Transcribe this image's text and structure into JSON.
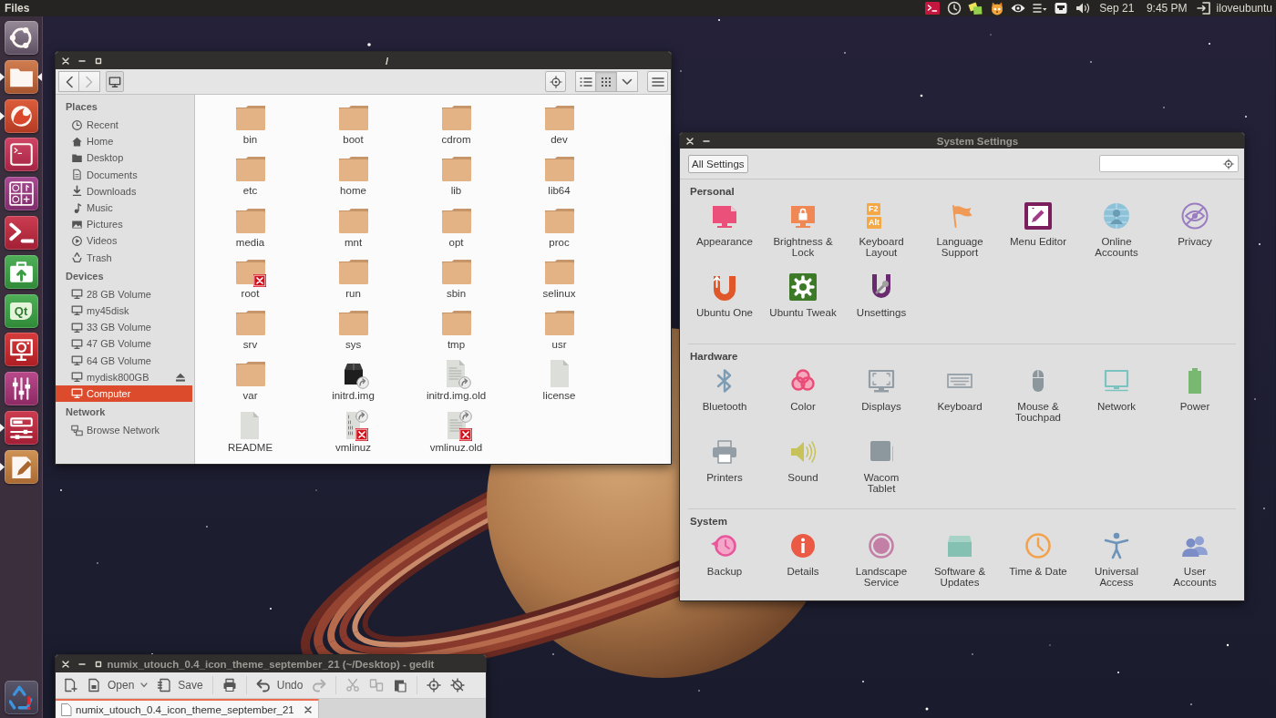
{
  "top_panel": {
    "app_title": "Files",
    "date": "Sep 21",
    "time": "9:45 PM",
    "user": "iloveubuntu"
  },
  "launcher": [
    {
      "running": false,
      "focused": false
    },
    {
      "running": true,
      "focused": true
    },
    {
      "running": true,
      "focused": false
    },
    {
      "running": false,
      "focused": false
    },
    {
      "running": false,
      "focused": false
    },
    {
      "running": false,
      "focused": false
    },
    {
      "running": false,
      "focused": false
    },
    {
      "running": false,
      "focused": false,
      "logo_text": "Qt"
    },
    {
      "running": false,
      "focused": false
    },
    {
      "running": false,
      "focused": false
    },
    {
      "running": true,
      "focused": false
    },
    {
      "running": true,
      "focused": false
    }
  ],
  "file_manager": {
    "title": "/",
    "nav": [
      {
        "disabled": false
      },
      {
        "disabled": true
      }
    ],
    "view_modes": [
      {
        "selected": false
      },
      {
        "selected": true
      }
    ],
    "sidebar": [
      {
        "heading": "Places",
        "items": [
          {
            "label": "Recent",
            "selected": false
          },
          {
            "label": "Home",
            "selected": false
          },
          {
            "label": "Desktop",
            "selected": false
          },
          {
            "label": "Documents",
            "selected": false
          },
          {
            "label": "Downloads",
            "selected": false
          },
          {
            "label": "Music",
            "selected": false
          },
          {
            "label": "Pictures",
            "selected": false
          },
          {
            "label": "Videos",
            "selected": false
          },
          {
            "label": "Trash",
            "selected": false
          }
        ]
      },
      {
        "heading": "Devices",
        "items": [
          {
            "label": "28 GB Volume",
            "selected": false,
            "eject": false
          },
          {
            "label": "my45disk",
            "selected": false,
            "eject": false
          },
          {
            "label": "33 GB Volume",
            "selected": false,
            "eject": false
          },
          {
            "label": "47 GB Volume",
            "selected": false,
            "eject": false
          },
          {
            "label": "64 GB Volume",
            "selected": false,
            "eject": false
          },
          {
            "label": "mydisk800GB",
            "selected": false,
            "eject": true
          },
          {
            "label": "Computer",
            "selected": true,
            "eject": false
          }
        ]
      },
      {
        "heading": "Network",
        "items": [
          {
            "label": "Browse Network",
            "selected": false
          }
        ]
      }
    ],
    "files": [
      {
        "name": "bin",
        "kind": "folder",
        "link": false,
        "unreadable": false
      },
      {
        "name": "boot",
        "kind": "folder",
        "link": false,
        "unreadable": false
      },
      {
        "name": "cdrom",
        "kind": "folder",
        "link": false,
        "unreadable": false
      },
      {
        "name": "dev",
        "kind": "folder",
        "link": false,
        "unreadable": false
      },
      {
        "name": "etc",
        "kind": "folder",
        "link": false,
        "unreadable": false
      },
      {
        "name": "home",
        "kind": "folder",
        "link": false,
        "unreadable": false
      },
      {
        "name": "lib",
        "kind": "folder",
        "link": false,
        "unreadable": false
      },
      {
        "name": "lib64",
        "kind": "folder",
        "link": false,
        "unreadable": false
      },
      {
        "name": "media",
        "kind": "folder",
        "link": false,
        "unreadable": false
      },
      {
        "name": "mnt",
        "kind": "folder",
        "link": false,
        "unreadable": false
      },
      {
        "name": "opt",
        "kind": "folder",
        "link": false,
        "unreadable": false
      },
      {
        "name": "proc",
        "kind": "folder",
        "link": false,
        "unreadable": false
      },
      {
        "name": "root",
        "kind": "folder",
        "link": false,
        "unreadable": true
      },
      {
        "name": "run",
        "kind": "folder",
        "link": false,
        "unreadable": false
      },
      {
        "name": "sbin",
        "kind": "folder",
        "link": false,
        "unreadable": false
      },
      {
        "name": "selinux",
        "kind": "folder",
        "link": false,
        "unreadable": false
      },
      {
        "name": "srv",
        "kind": "folder",
        "link": false,
        "unreadable": false
      },
      {
        "name": "sys",
        "kind": "folder",
        "link": false,
        "unreadable": false
      },
      {
        "name": "tmp",
        "kind": "folder",
        "link": false,
        "unreadable": false
      },
      {
        "name": "usr",
        "kind": "folder",
        "link": false,
        "unreadable": false
      },
      {
        "name": "var",
        "kind": "folder",
        "link": false,
        "unreadable": false
      },
      {
        "name": "initrd.img",
        "kind": "package",
        "link": true,
        "unreadable": false
      },
      {
        "name": "initrd.img.old",
        "kind": "text",
        "link": true,
        "unreadable": false
      },
      {
        "name": "license",
        "kind": "plain",
        "link": false,
        "unreadable": false
      },
      {
        "name": "README",
        "kind": "plain",
        "link": false,
        "unreadable": false
      },
      {
        "name": "vmlinuz",
        "kind": "binary",
        "link": true,
        "unreadable": true
      },
      {
        "name": "vmlinuz.old",
        "kind": "text",
        "link": true,
        "unreadable": true
      }
    ]
  },
  "system_settings": {
    "title": "System Settings",
    "all_settings_button": "All Settings",
    "sections": [
      {
        "heading": "Personal",
        "items": [
          {
            "label": "Appearance"
          },
          {
            "label": "Brightness &\nLock"
          },
          {
            "label": "Keyboard\nLayout",
            "keycaps": [
              "F2",
              "Alt"
            ]
          },
          {
            "label": "Language\nSupport"
          },
          {
            "label": "Menu Editor"
          },
          {
            "label": "Online\nAccounts"
          },
          {
            "label": "Privacy"
          },
          {
            "label": "Ubuntu One"
          },
          {
            "label": "Ubuntu Tweak"
          },
          {
            "label": "Unsettings"
          }
        ]
      },
      {
        "heading": "Hardware",
        "items": [
          {
            "label": "Bluetooth"
          },
          {
            "label": "Color"
          },
          {
            "label": "Displays"
          },
          {
            "label": "Keyboard"
          },
          {
            "label": "Mouse &\nTouchpad"
          },
          {
            "label": "Network"
          },
          {
            "label": "Power"
          },
          {
            "label": "Printers"
          },
          {
            "label": "Sound"
          },
          {
            "label": "Wacom\nTablet"
          }
        ]
      },
      {
        "heading": "System",
        "items": [
          {
            "label": "Backup"
          },
          {
            "label": "Details"
          },
          {
            "label": "Landscape\nService"
          },
          {
            "label": "Software &\nUpdates"
          },
          {
            "label": "Time & Date"
          },
          {
            "label": "Universal\nAccess"
          },
          {
            "label": "User\nAccounts"
          }
        ]
      }
    ]
  },
  "text_editor": {
    "title": "numix_utouch_0.4_icon_theme_september_21 (~/Desktop) - gedit",
    "toolbar": [
      [
        {
          "disabled": false
        },
        {
          "label": "Open",
          "disabled": false
        },
        {
          "label": "Save",
          "disabled": false
        }
      ],
      [
        {
          "disabled": false
        }
      ],
      [
        {
          "label": "Undo",
          "disabled": false
        },
        {
          "disabled": true
        }
      ],
      [
        {
          "disabled": true
        },
        {
          "disabled": true
        },
        {
          "disabled": false
        }
      ],
      [
        {
          "disabled": false
        },
        {
          "disabled": false
        }
      ]
    ],
    "tabs": [
      {
        "label": "numix_utouch_0.4_icon_theme_september_21",
        "selected": true
      }
    ]
  }
}
